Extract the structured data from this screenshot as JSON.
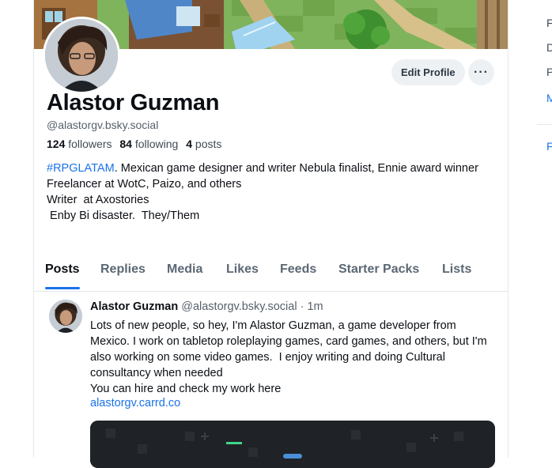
{
  "profile": {
    "name": "Alastor Guzman",
    "handle": "@alastorgv.bsky.social",
    "followers_count": "124",
    "followers_label": "followers",
    "following_count": "84",
    "following_label": "following",
    "posts_count": "4",
    "posts_label": "posts",
    "bio_tag": "#RPGLATAM",
    "bio_rest": ". Mexican game designer and writer Nebula finalist, Ennie award winner\nFreelancer at WotC, Paizo, and others\nWriter  at Axostories\n Enby Bi disaster.  They/Them"
  },
  "actions": {
    "edit_profile": "Edit Profile",
    "more": "···"
  },
  "tabs": [
    {
      "label": "Posts",
      "active": true
    },
    {
      "label": "Replies",
      "active": false
    },
    {
      "label": "Media",
      "active": false
    },
    {
      "label": "Likes",
      "active": false
    },
    {
      "label": "Feeds",
      "active": false
    },
    {
      "label": "Starter Packs",
      "active": false
    },
    {
      "label": "Lists",
      "active": false
    }
  ],
  "post": {
    "author": "Alastor Guzman",
    "handle": "@alastorgv.bsky.social",
    "time": " · 1m",
    "text": "Lots of new people, so hey, I'm Alastor Guzman, a game developer from Mexico. I work on tabletop roleplaying games, card games, and others, but I'm also working on some video games.  I enjoy writing and doing Cultural consultancy when needed\nYou can hire and check my work here",
    "link": "alastorgv.carrd.co"
  },
  "right_sidebar": {
    "items": [
      "F",
      "D",
      "P",
      "M",
      "F"
    ]
  },
  "colors": {
    "accent": "#1a73e8",
    "text": "#0b0f14",
    "muted": "#56616b",
    "border": "#e3e8ec"
  }
}
